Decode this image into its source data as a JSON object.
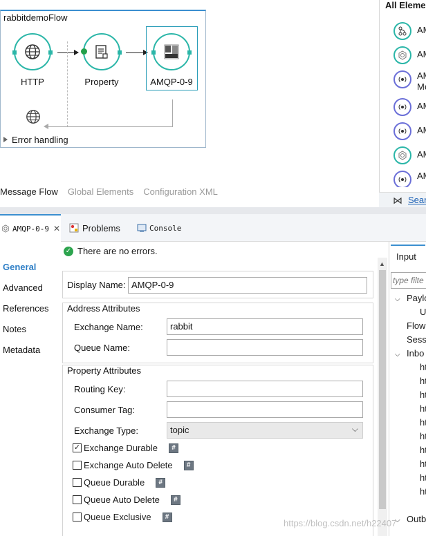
{
  "flow": {
    "title": "rabbitdemoFlow",
    "nodes": [
      {
        "label": "HTTP",
        "icon": "globe-icon"
      },
      {
        "label": "Property",
        "icon": "document-icon"
      },
      {
        "label": "AMQP-0-9",
        "icon": "amqp-icon"
      }
    ],
    "error_handling": "Error handling"
  },
  "editor_tabs": [
    "Message Flow",
    "Global Elements",
    "Configuration XML"
  ],
  "palette": {
    "title": "All Elements",
    "items": [
      {
        "text": "AM",
        "icon": "connector-icon"
      },
      {
        "text": "AM",
        "icon": "gear-icon"
      },
      {
        "text": "AM\nMe",
        "icon": "radio-icon"
      },
      {
        "text": "AM",
        "icon": "radio-icon"
      },
      {
        "text": "AM",
        "icon": "radio-icon"
      },
      {
        "text": "AM",
        "icon": "gear-icon"
      },
      {
        "text": "AM",
        "icon": "radio-icon"
      }
    ],
    "search_link": "Sear"
  },
  "prop_tabs": {
    "active": "AMQP-0-9",
    "problems": "Problems",
    "console": "Console"
  },
  "nav": [
    "General",
    "Advanced",
    "References",
    "Notes",
    "Metadata"
  ],
  "status": "There are no errors.",
  "display_name": {
    "label": "Display Name:",
    "value": "AMQP-0-9"
  },
  "address": {
    "title": "Address Attributes",
    "exchange_name_label": "Exchange Name:",
    "exchange_name_value": "rabbit",
    "queue_name_label": "Queue Name:",
    "queue_name_value": ""
  },
  "property": {
    "title": "Property Attributes",
    "routing_key_label": "Routing Key:",
    "routing_key_value": "",
    "consumer_tag_label": "Consumer Tag:",
    "consumer_tag_value": "",
    "exchange_type_label": "Exchange Type:",
    "exchange_type_value": "topic",
    "checkboxes": [
      {
        "label": "Exchange Durable",
        "checked": true
      },
      {
        "label": "Exchange Auto Delete",
        "checked": false
      },
      {
        "label": "Queue Durable",
        "checked": false
      },
      {
        "label": "Queue Auto Delete",
        "checked": false
      },
      {
        "label": "Queue Exclusive",
        "checked": false
      }
    ],
    "hash_label": "#"
  },
  "input_panel": {
    "tab": "Input",
    "filter_placeholder": "type filte",
    "tree": [
      "Paylo",
      "U",
      "Flow",
      "Sessi",
      "Inbo",
      "ht",
      "ht",
      "ht",
      "ht",
      "ht",
      "ht",
      "ht",
      "ht",
      "ht",
      "ht",
      "Outb"
    ]
  },
  "watermark": "https://blog.csdn.net/h22407"
}
